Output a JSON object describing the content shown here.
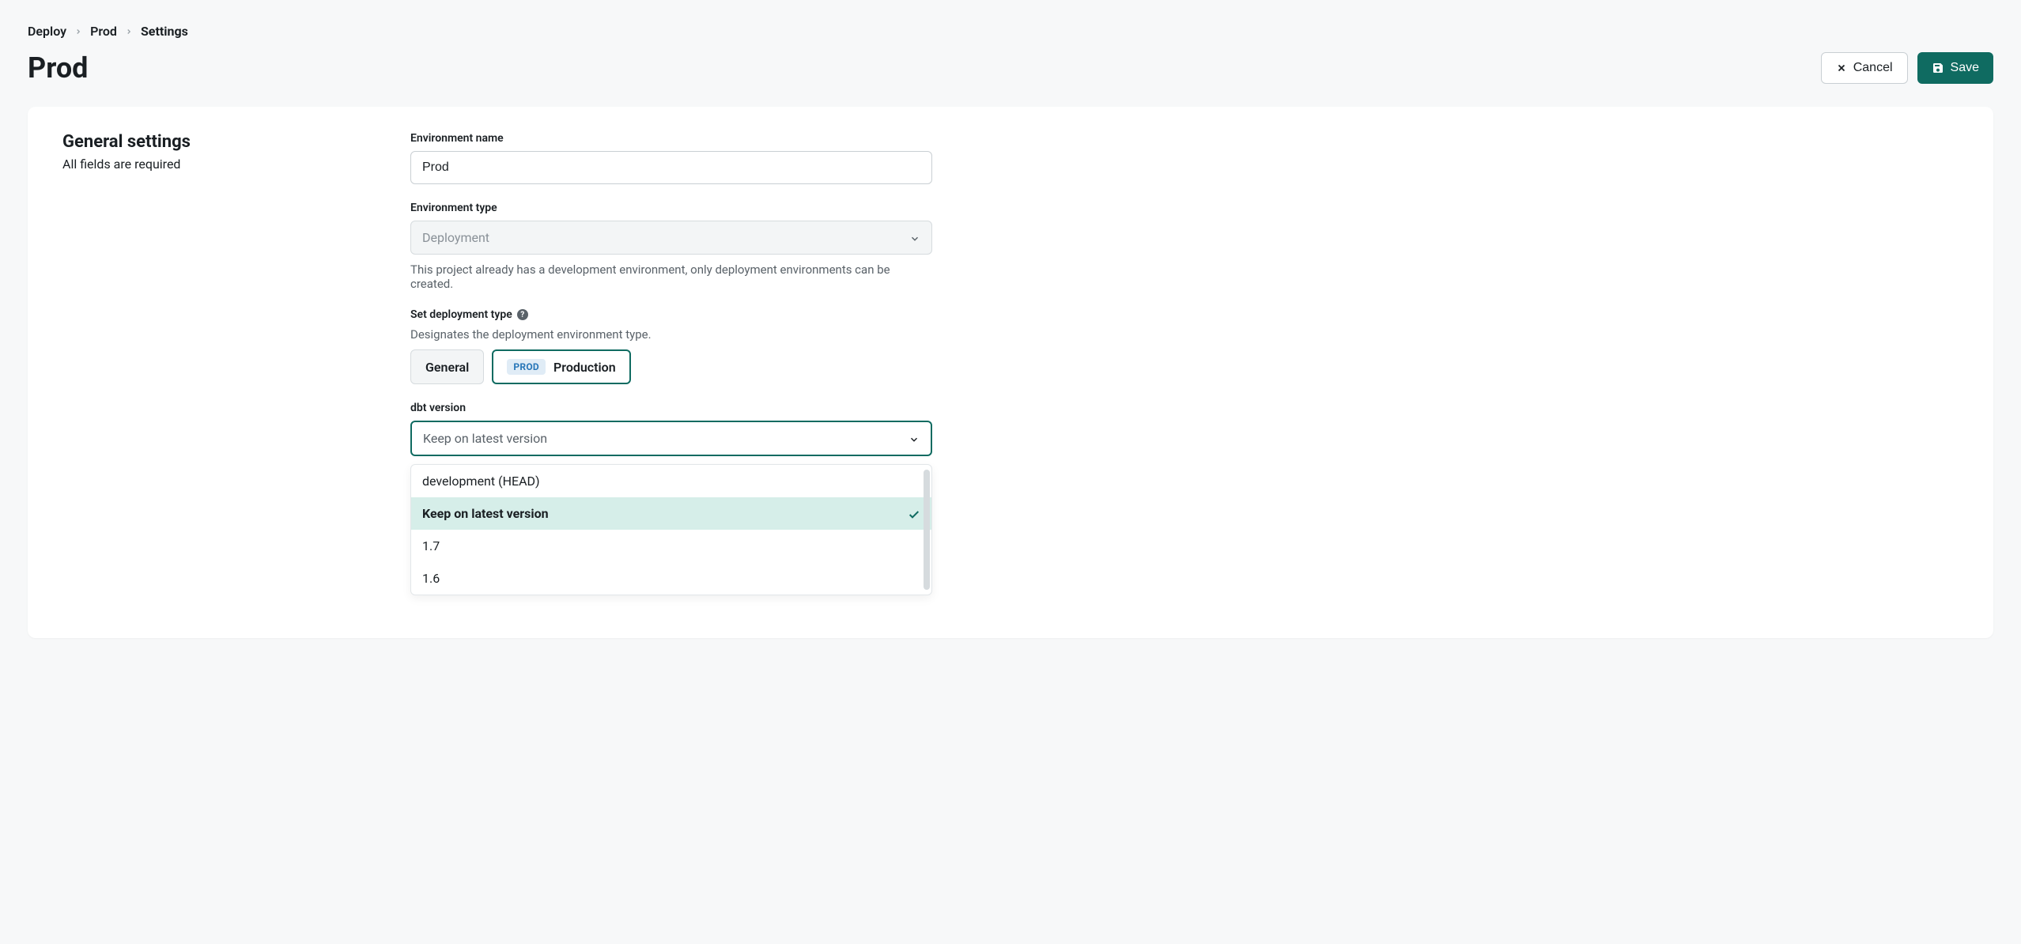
{
  "breadcrumb": {
    "items": [
      "Deploy",
      "Prod",
      "Settings"
    ]
  },
  "page_title": "Prod",
  "actions": {
    "cancel_label": "Cancel",
    "save_label": "Save"
  },
  "section": {
    "heading": "General settings",
    "subheading": "All fields are required"
  },
  "fields": {
    "env_name": {
      "label": "Environment name",
      "value": "Prod"
    },
    "env_type": {
      "label": "Environment type",
      "value": "Deployment",
      "hint": "This project already has a development environment, only deployment environments can be created."
    },
    "deployment_type": {
      "label": "Set deployment type",
      "sublabel": "Designates the deployment environment type.",
      "options": {
        "general": "General",
        "prod_badge": "PROD",
        "production": "Production"
      }
    },
    "dbt_version": {
      "label": "dbt version",
      "value": "Keep on latest version",
      "options": [
        {
          "label": "development (HEAD)",
          "selected": false
        },
        {
          "label": "Keep on latest version",
          "selected": true
        },
        {
          "label": "1.7",
          "selected": false
        },
        {
          "label": "1.6",
          "selected": false
        }
      ]
    }
  }
}
